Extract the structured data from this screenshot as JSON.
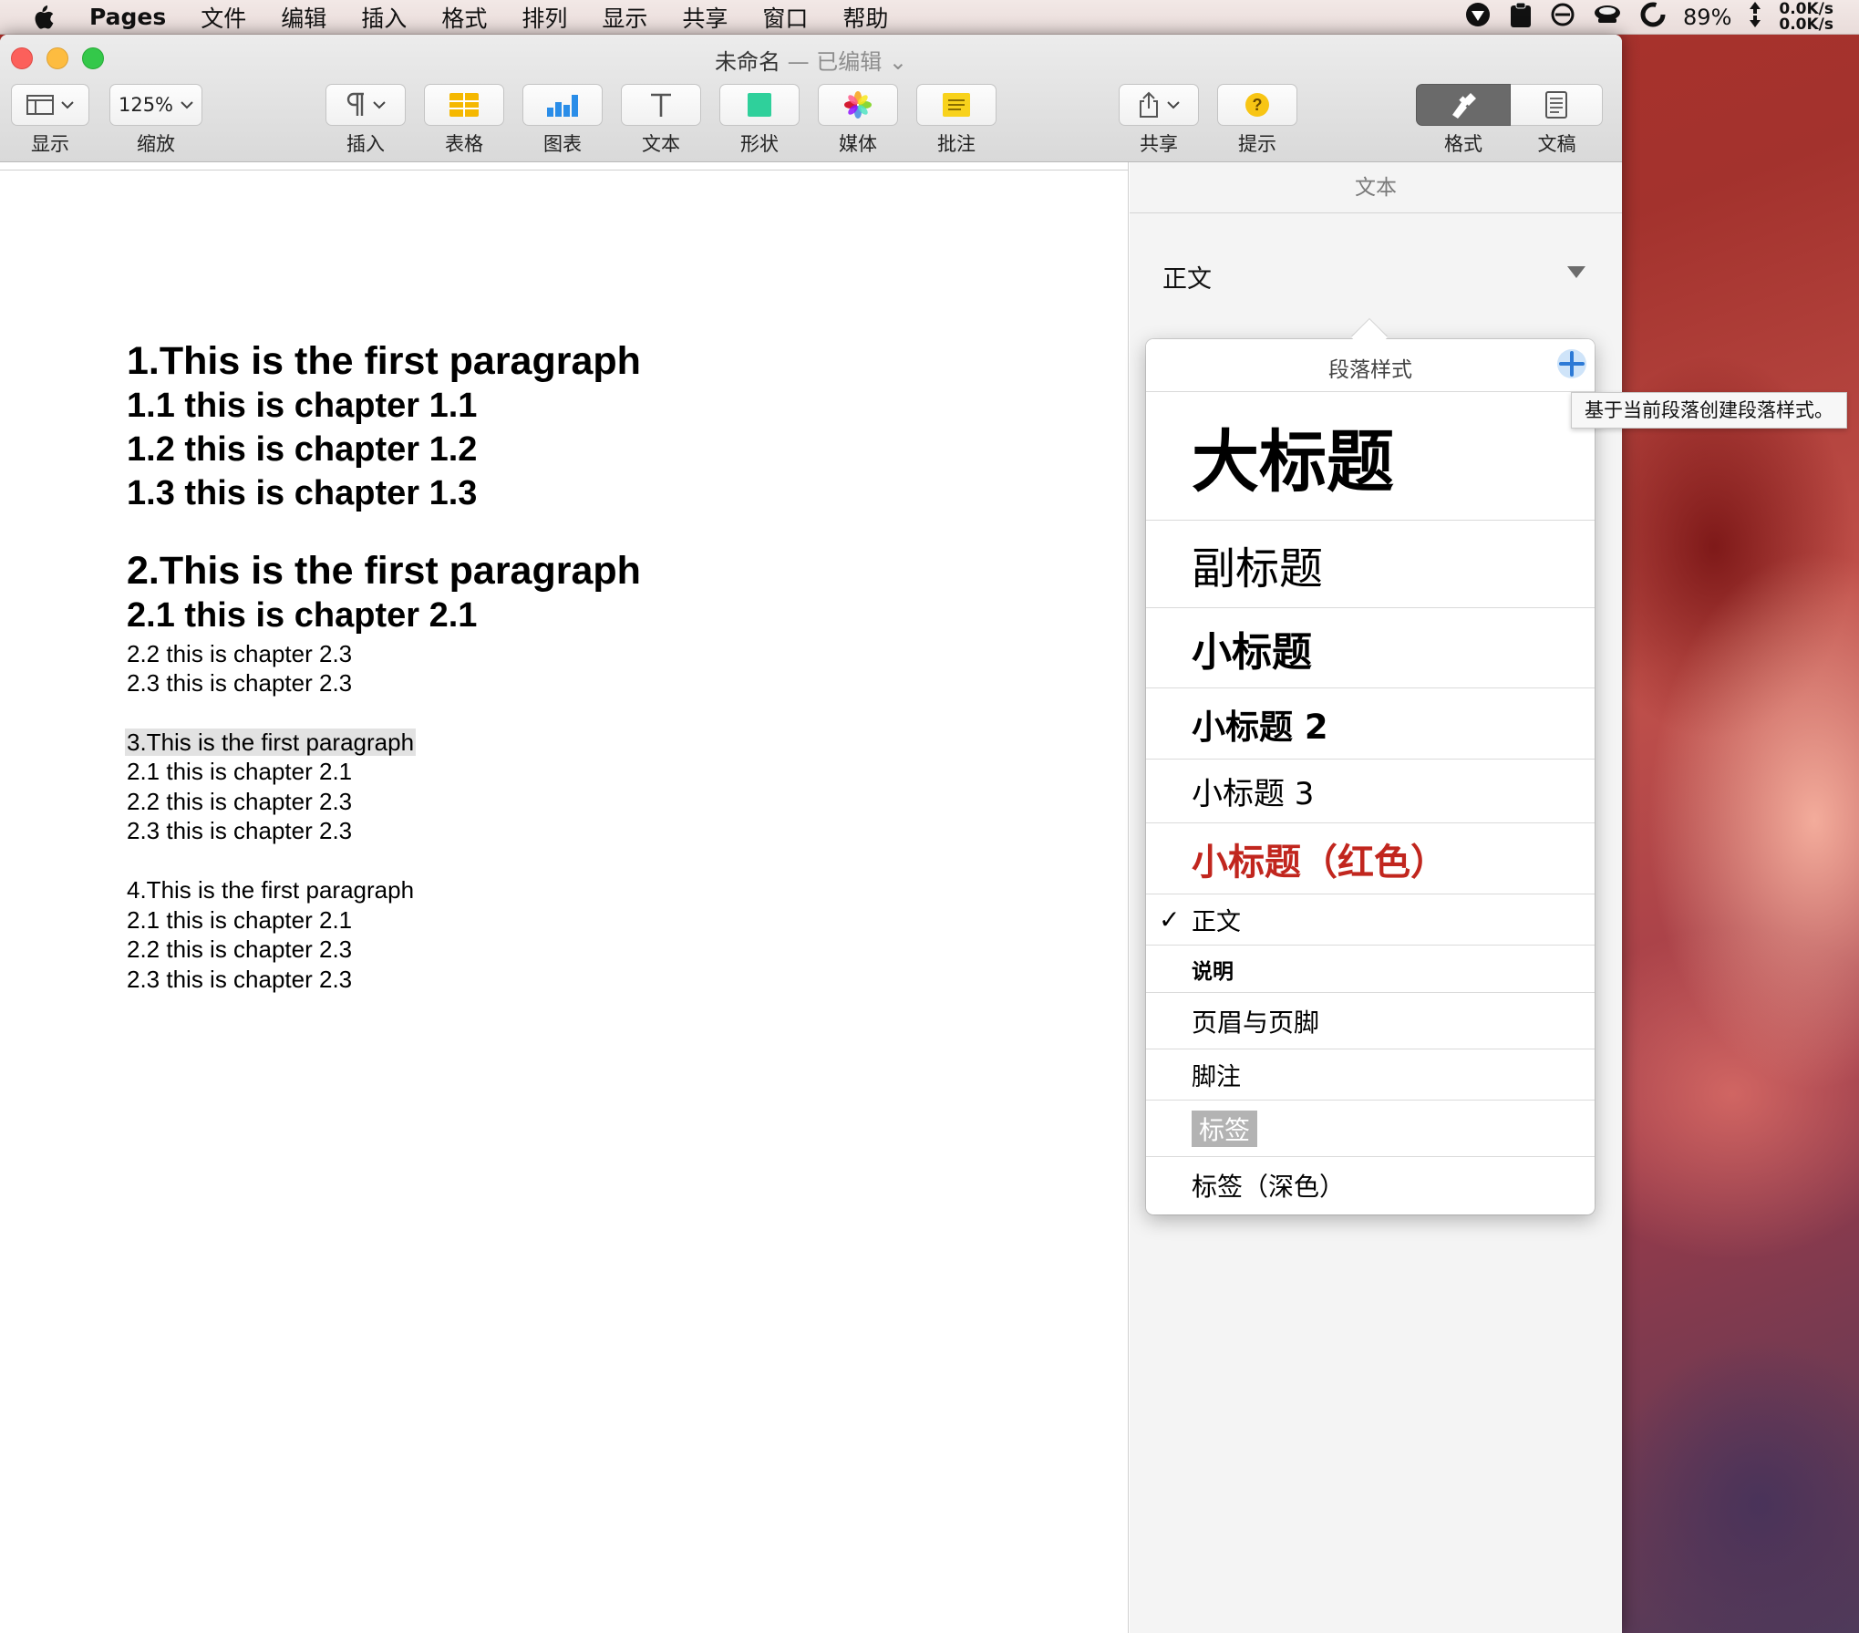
{
  "menubar": {
    "app_name": "Pages",
    "items": [
      "文件",
      "编辑",
      "插入",
      "格式",
      "排列",
      "显示",
      "共享",
      "窗口",
      "帮助"
    ],
    "battery_percent": "89%",
    "net_up": "0.0K/s",
    "net_down": "0.0K/s"
  },
  "window": {
    "title": "未命名",
    "title_status": "— 已编辑"
  },
  "toolbar": {
    "view_label": "显示",
    "zoom_value": "125%",
    "zoom_label": "缩放",
    "insert_label": "插入",
    "table_label": "表格",
    "chart_label": "图表",
    "text_label": "文本",
    "shape_label": "形状",
    "media_label": "媒体",
    "comment_label": "批注",
    "share_label": "共享",
    "tips_label": "提示",
    "format_label": "格式",
    "document_label": "文稿"
  },
  "document": {
    "lines": [
      "1.This is the first paragraph",
      "1.1 this is chapter 1.1",
      "1.2 this is chapter 1.2",
      "1.3 this is chapter 1.3",
      "2.This is the first paragraph",
      "2.1 this is chapter 2.1",
      "2.2 this is chapter 2.3",
      "2.3 this is chapter 2.3",
      "3.This is the first paragraph",
      "2.1 this is chapter 2.1",
      "2.2 this is chapter 2.3",
      "2.3 this is chapter 2.3",
      "4.This is the first paragraph",
      "2.1 this is chapter 2.1",
      "2.2 this is chapter 2.3",
      "2.3 this is chapter 2.3"
    ]
  },
  "inspector": {
    "tab": "文本",
    "current_style": "正文"
  },
  "popover": {
    "title": "段落样式",
    "tooltip": "基于当前段落创建段落样式。",
    "styles": [
      "大标题",
      "副标题",
      "小标题",
      "小标题 2",
      "小标题 3",
      "小标题（红色）",
      "正文",
      "说明",
      "页眉与页脚",
      "脚注",
      "标签",
      "标签（深色）"
    ],
    "selected_style": "正文",
    "checkmark": "✓",
    "accent_red": "#c1261e"
  }
}
